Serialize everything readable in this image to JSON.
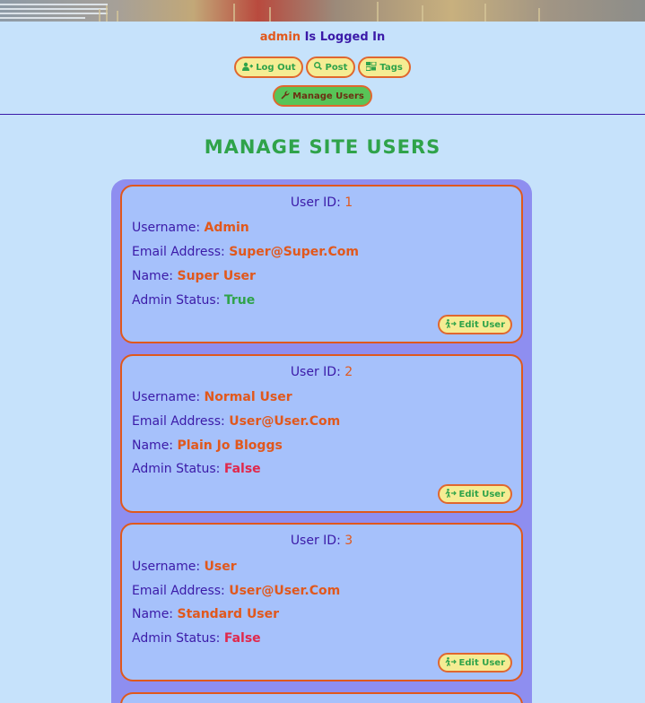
{
  "header": {
    "username": "admin",
    "status_text": "Is Logged In"
  },
  "nav": {
    "logout_label": "Log Out",
    "post_label": "Post",
    "tags_label": "Tags",
    "manage_users_label": "Manage Users"
  },
  "page": {
    "title": "MANAGE SITE USERS"
  },
  "labels": {
    "user_id": "User ID:",
    "username": "Username:",
    "email": "Email Address:",
    "name": "Name:",
    "admin_status": "Admin Status:",
    "edit_button": "Edit User"
  },
  "users": [
    {
      "id": "1",
      "username": "Admin",
      "email": "Super@Super.Com",
      "name": "Super User",
      "admin_status": "True"
    },
    {
      "id": "2",
      "username": "Normal User",
      "email": "User@User.Com",
      "name": "Plain Jo Bloggs",
      "admin_status": "False"
    },
    {
      "id": "3",
      "username": "User",
      "email": "User@User.Com",
      "name": "Standard User",
      "admin_status": "False"
    }
  ],
  "colors": {
    "background": "#c6e2fb",
    "primary_text": "#3b1aa8",
    "accent_orange": "#e1581c",
    "accent_green": "#2fa34a",
    "false_red": "#e0284c",
    "button_yellow": "#f5ec93",
    "panel": "#8e8ef0",
    "card": "#a6c1fb"
  },
  "icons": {
    "logout": "user-minus-icon",
    "post": "search-plus-icon",
    "tags": "tags-icon",
    "manage": "wrench-icon",
    "edit": "person-walking-arrow-icon"
  }
}
